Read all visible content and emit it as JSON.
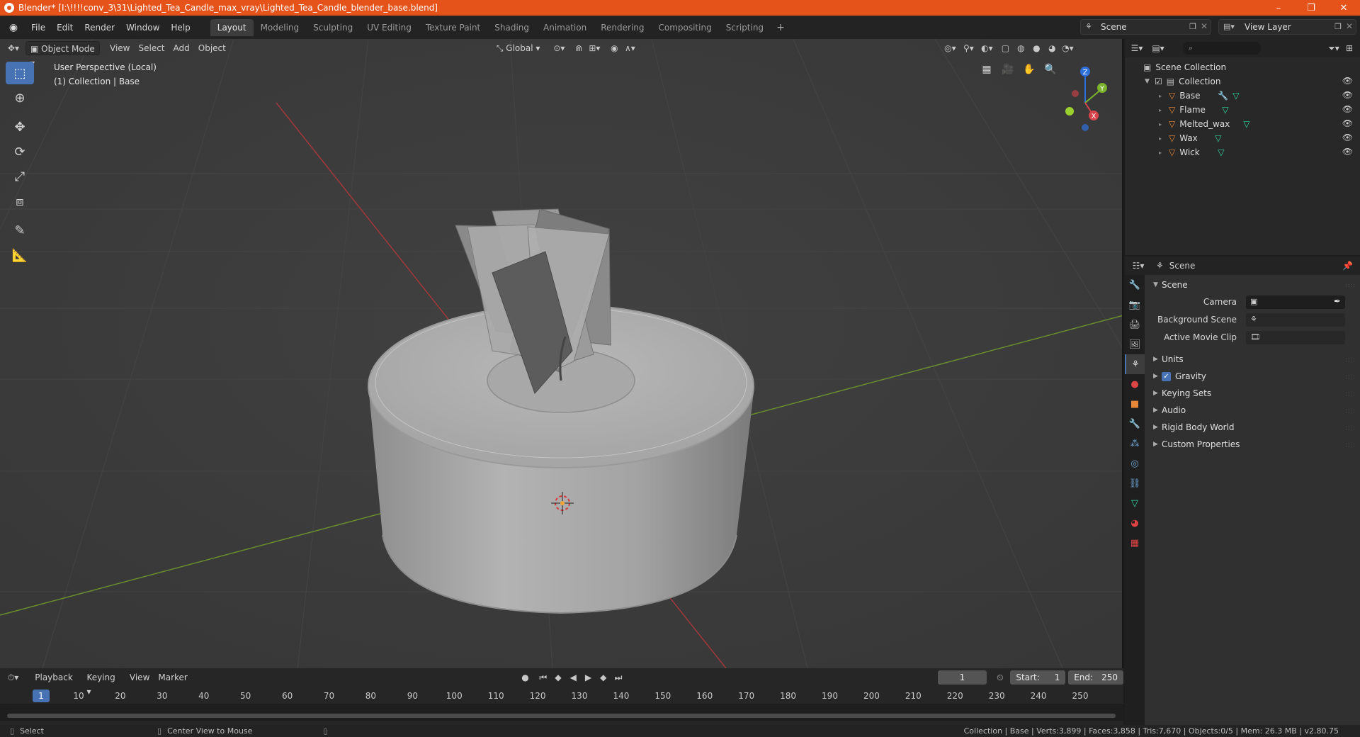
{
  "window": {
    "title": "Blender* [I:\\!!!!conv_3\\31\\Lighted_Tea_Candle_max_vray\\Lighted_Tea_Candle_blender_base.blend]",
    "controls": [
      "–",
      "❐",
      "✕"
    ]
  },
  "menu": [
    "File",
    "Edit",
    "Render",
    "Window",
    "Help"
  ],
  "workspaces": [
    "Layout",
    "Modeling",
    "Sculpting",
    "UV Editing",
    "Texture Paint",
    "Shading",
    "Animation",
    "Rendering",
    "Compositing",
    "Scripting"
  ],
  "active_workspace": "Layout",
  "scene_selector": "Scene",
  "view_layer_selector": "View Layer",
  "viewport": {
    "mode": "Object Mode",
    "menus": [
      "View",
      "Select",
      "Add",
      "Object"
    ],
    "orientation": "Global",
    "info_line1": "User Perspective (Local)",
    "info_line2": "(1) Collection | Base",
    "gizmo_axes": {
      "x": "X",
      "y": "Y",
      "z": "Z"
    }
  },
  "timeline": {
    "menus": [
      "Playback",
      "Keying",
      "View",
      "Marker"
    ],
    "current_frame": "1",
    "start_label": "Start:",
    "start_value": "1",
    "end_label": "End:",
    "end_value": "250",
    "ticks": [
      "1",
      "10",
      "20",
      "30",
      "40",
      "50",
      "60",
      "70",
      "80",
      "90",
      "100",
      "110",
      "120",
      "130",
      "140",
      "150",
      "160",
      "170",
      "180",
      "190",
      "200",
      "210",
      "220",
      "230",
      "240",
      "250"
    ]
  },
  "status": {
    "left1": "Select",
    "left2": "Center View to Mouse",
    "right": "Collection | Base | Verts:3,899 | Faces:3,858 | Tris:7,670 | Objects:0/5 | Mem: 26.3 MB | v2.80.75"
  },
  "outliner": {
    "root": "Scene Collection",
    "collection": "Collection",
    "objects": [
      "Base",
      "Flame",
      "Melted_wax",
      "Wax",
      "Wick"
    ]
  },
  "properties": {
    "context": "Scene",
    "panel_title": "Scene",
    "fields": [
      {
        "label": "Camera"
      },
      {
        "label": "Background Scene"
      },
      {
        "label": "Active Movie Clip"
      }
    ],
    "subpanels": [
      "Units",
      "Gravity",
      "Keying Sets",
      "Audio",
      "Rigid Body World",
      "Custom Properties"
    ]
  },
  "colors": {
    "title_bar": "#e5531a",
    "accent": "#4772b3",
    "object_icon": "#e8883a",
    "mesh_data_icon": "#36d5a4"
  }
}
